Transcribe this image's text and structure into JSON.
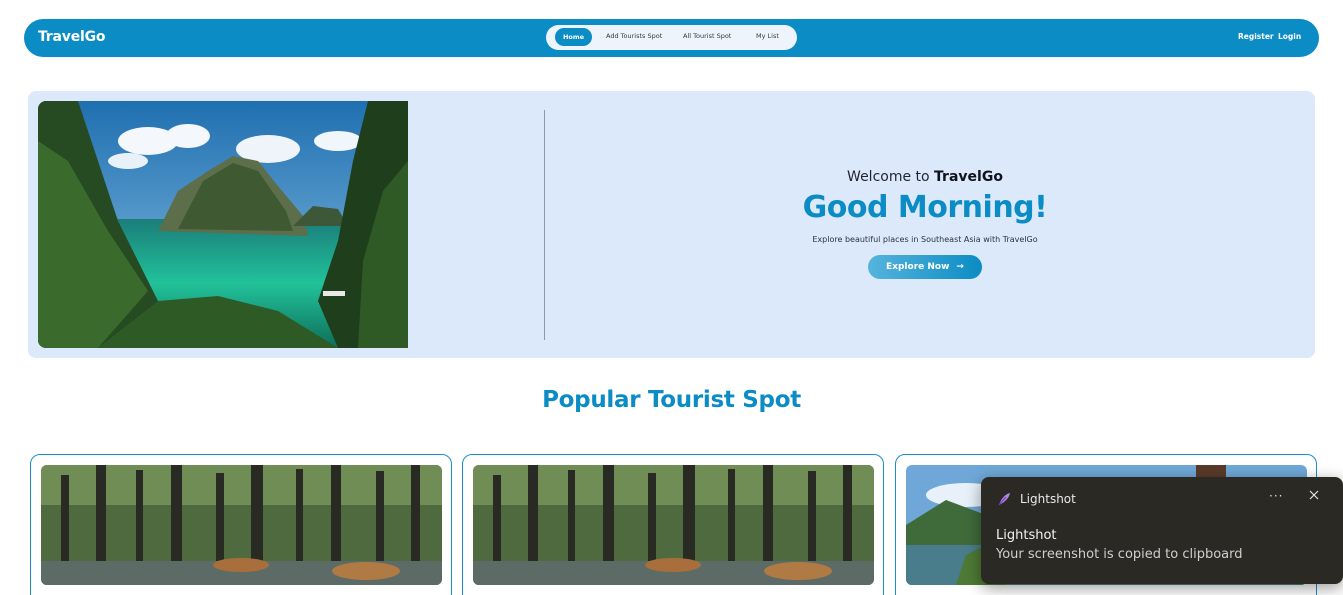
{
  "navbar": {
    "brand": "TravelGo",
    "links": [
      "Home",
      "Add Tourists Spot",
      "All Tourist Spot",
      "My List"
    ],
    "register": "Register",
    "login": "Login"
  },
  "hero": {
    "welcome_prefix": "Welcome to ",
    "welcome_brand": "TravelGo",
    "greeting": "Good Morning!",
    "tagline": "Explore beautiful places in Southeast Asia with TravelGo",
    "button": "Explore Now",
    "button_arrow": "→"
  },
  "section": {
    "title": "Popular Tourist Spot"
  },
  "toast": {
    "app_name": "Lightshot",
    "title": "Lightshot",
    "message": "Your screenshot is copied to clipboard",
    "more": "···"
  },
  "colors": {
    "brand": "#0b8cc4",
    "hero_bg": "#dbe9fb",
    "toast_bg": "#2b2924"
  }
}
